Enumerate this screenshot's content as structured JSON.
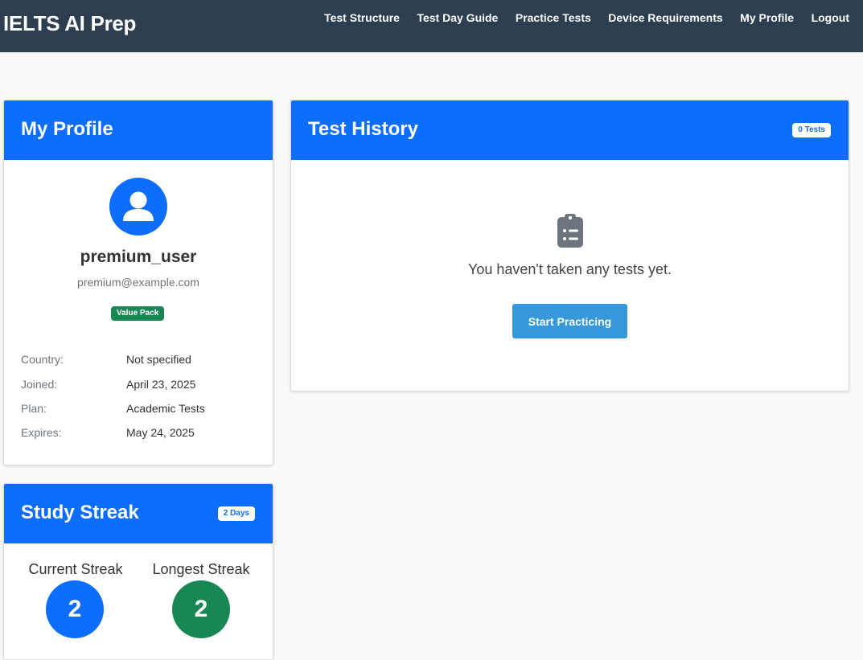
{
  "nav": {
    "brand": "IELTS AI Prep",
    "links": [
      {
        "label": "Test Structure"
      },
      {
        "label": "Test Day Guide"
      },
      {
        "label": "Practice Tests"
      },
      {
        "label": "Device Requirements"
      },
      {
        "label": "My Profile"
      },
      {
        "label": "Logout"
      }
    ]
  },
  "profile": {
    "title": "My Profile",
    "username": "premium_user",
    "email": "premium@example.com",
    "plan_badge": "Value Pack",
    "details": [
      {
        "label": "Country:",
        "value": "Not specified"
      },
      {
        "label": "Joined:",
        "value": "April 23, 2025"
      },
      {
        "label": "Plan:",
        "value": "Academic Tests"
      },
      {
        "label": "Expires:",
        "value": "May 24, 2025"
      }
    ]
  },
  "history": {
    "title": "Test History",
    "count_badge": "0 Tests",
    "empty_message": "You haven't taken any tests yet.",
    "start_button": "Start Practicing"
  },
  "streak": {
    "title": "Study Streak",
    "days_badge": "2 Days",
    "current_label": "Current Streak",
    "current_value": "2",
    "longest_label": "Longest Streak",
    "longest_value": "2"
  },
  "colors": {
    "navbar": "#2c3e50",
    "header_blue": "#0d6efd",
    "success_green": "#198754",
    "button_blue": "#3498db"
  }
}
